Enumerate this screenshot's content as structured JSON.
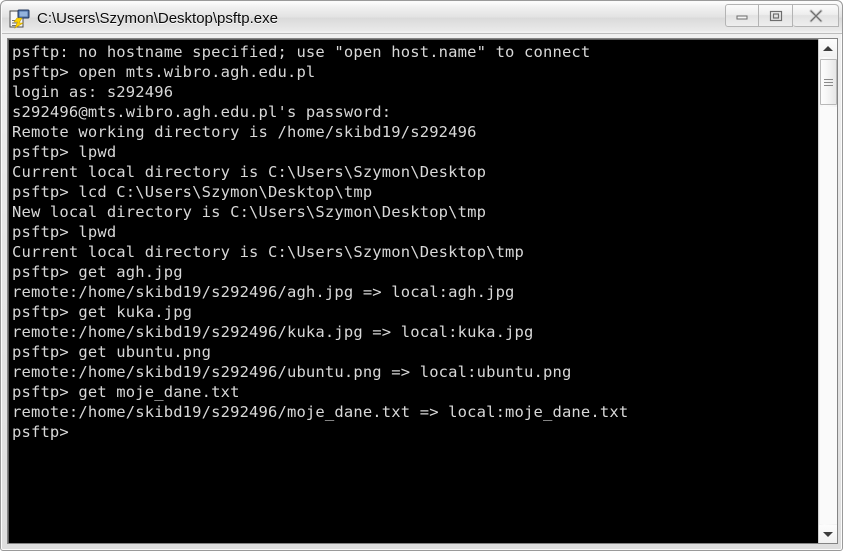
{
  "window": {
    "title": "C:\\Users\\Szymon\\Desktop\\psftp.exe",
    "icon": "psftp-app-icon",
    "controls": {
      "minimize_label": "–",
      "maximize_label": "□",
      "close_label": "✕"
    },
    "colors": {
      "titlebar_bg": "#e7e7e7",
      "window_border": "#9a9a9a",
      "terminal_bg": "#000000",
      "terminal_fg": "#d8d8d8"
    }
  },
  "terminal": {
    "prompt": "psftp>",
    "lines": [
      "psftp: no hostname specified; use \"open host.name\" to connect",
      "psftp> open mts.wibro.agh.edu.pl",
      "login as: s292496",
      "s292496@mts.wibro.agh.edu.pl's password:",
      "Remote working directory is /home/skibd19/s292496",
      "psftp> lpwd",
      "Current local directory is C:\\Users\\Szymon\\Desktop",
      "psftp> lcd C:\\Users\\Szymon\\Desktop\\tmp",
      "New local directory is C:\\Users\\Szymon\\Desktop\\tmp",
      "psftp> lpwd",
      "Current local directory is C:\\Users\\Szymon\\Desktop\\tmp",
      "psftp> get agh.jpg",
      "remote:/home/skibd19/s292496/agh.jpg => local:agh.jpg",
      "psftp> get kuka.jpg",
      "remote:/home/skibd19/s292496/kuka.jpg => local:kuka.jpg",
      "psftp> get ubuntu.png",
      "remote:/home/skibd19/s292496/ubuntu.png => local:ubuntu.png",
      "psftp> get moje_dane.txt",
      "remote:/home/skibd19/s292496/moje_dane.txt => local:moje_dane.txt",
      "psftp>"
    ]
  },
  "scrollbar": {
    "up_arrow": "scroll-up-arrow",
    "down_arrow": "scroll-down-arrow",
    "thumb": "scroll-thumb"
  }
}
